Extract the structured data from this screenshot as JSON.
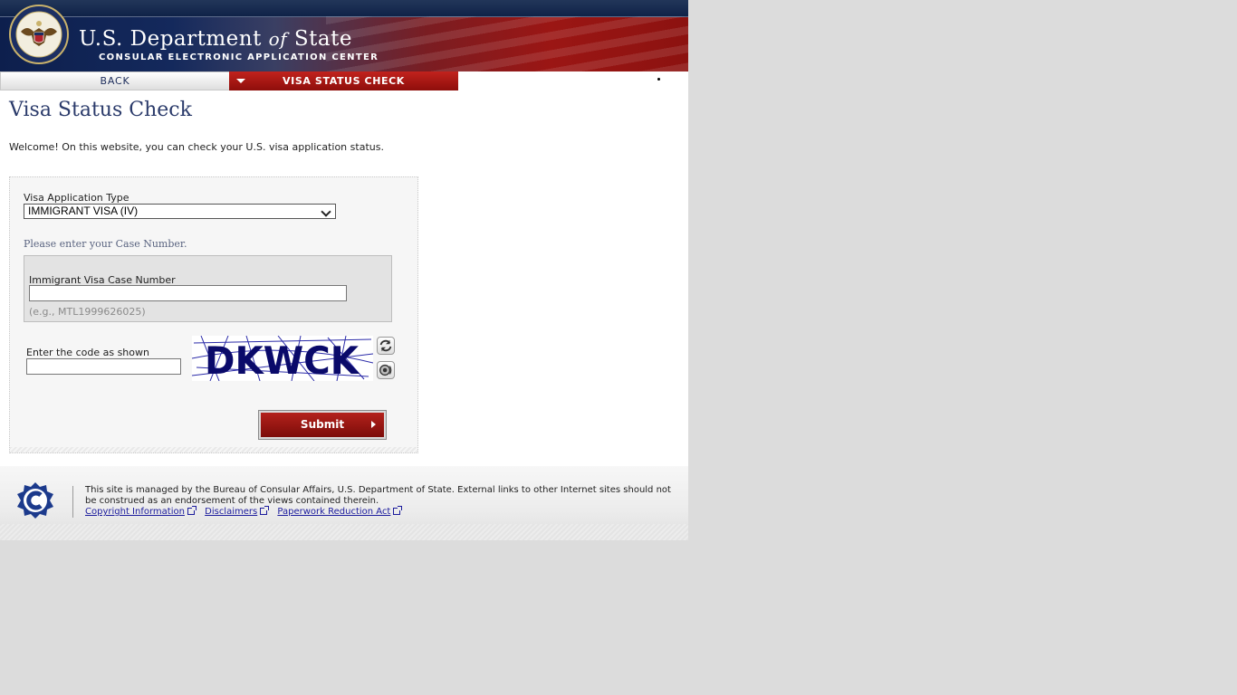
{
  "header": {
    "title_part1": "U.S. Department",
    "title_of": "of",
    "title_part2": "State",
    "subtitle": "CONSULAR ELECTRONIC APPLICATION CENTER",
    "seal_icon": "department-of-state-seal-icon"
  },
  "nav": {
    "back_label": "BACK",
    "current_label": "VISA STATUS CHECK"
  },
  "main": {
    "title": "Visa Status Check",
    "welcome": "Welcome! On this website, you can check your U.S. visa application status.",
    "form": {
      "type_label": "Visa Application Type",
      "type_selected": "IMMIGRANT VISA (IV)",
      "case_prompt": "Please enter your Case Number.",
      "case_label": "Immigrant Visa Case Number",
      "case_value": "",
      "case_example": "(e.g., MTL1999626025)",
      "code_label": "Enter the code as shown",
      "code_value": "",
      "captcha_text": "DKWCK",
      "submit_label": "Submit"
    }
  },
  "footer": {
    "notice": "This site is managed by the Bureau of Consular Affairs, U.S. Department of State. External links to other Internet sites should not be construed as an endorsement of the views contained therein.",
    "links": [
      "Copyright Information",
      "Disclaimers",
      "Paperwork Reduction Act"
    ],
    "logo_icon": "consular-affairs-logo-icon"
  },
  "colors": {
    "header_blue": "#14295c",
    "header_red": "#9b1614",
    "nav_active": "#b3221c",
    "title_text": "#2a3a6a",
    "link": "#1a1a9c"
  }
}
